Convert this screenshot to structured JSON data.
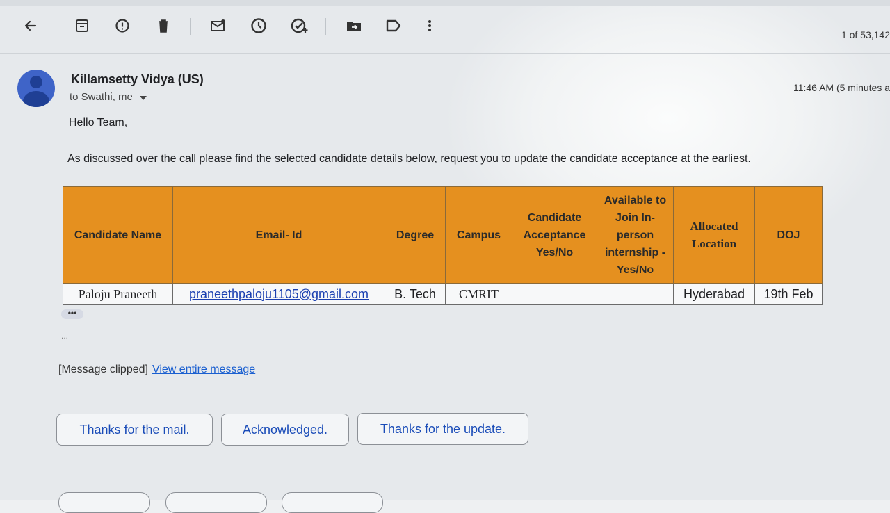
{
  "toolbar": {
    "icons": [
      "back-arrow-icon",
      "archive-icon",
      "report-spam-icon",
      "delete-icon",
      "mark-unread-icon",
      "snooze-icon",
      "add-task-icon",
      "move-to-icon",
      "label-icon",
      "more-vert-icon"
    ],
    "counter": "1 of 53,142"
  },
  "message": {
    "sender": "Killamsetty Vidya (US)",
    "recipients": "to Swathi, me",
    "time": "11:46 AM (5 minutes a",
    "greeting": "Hello Team,",
    "body": "As discussed over the call please find the selected candidate details below, request you to update the candidate acceptance at the earliest."
  },
  "table": {
    "headers": {
      "name": "Candidate Name",
      "email": "Email- Id",
      "degree": "Degree",
      "campus": "Campus",
      "acceptance": "Candidate Acceptance Yes/No",
      "available": "Available to Join In-person internship - Yes/No",
      "location": "Allocated Location",
      "doj": "DOJ"
    },
    "rows": [
      {
        "name": "Paloju Praneeth",
        "email": "praneethpaloju1105@gmail.com",
        "degree": "B. Tech",
        "campus": "CMRIT",
        "acceptance": "",
        "available": "",
        "location": "Hyderabad",
        "doj": "19th Feb"
      }
    ]
  },
  "footer": {
    "ellipsis": "•••",
    "small_dots": "...",
    "clipped_label": "[Message clipped]",
    "view_entire": "View entire message"
  },
  "smart_replies": [
    "Thanks for the mail.",
    "Acknowledged.",
    "Thanks for the update."
  ]
}
